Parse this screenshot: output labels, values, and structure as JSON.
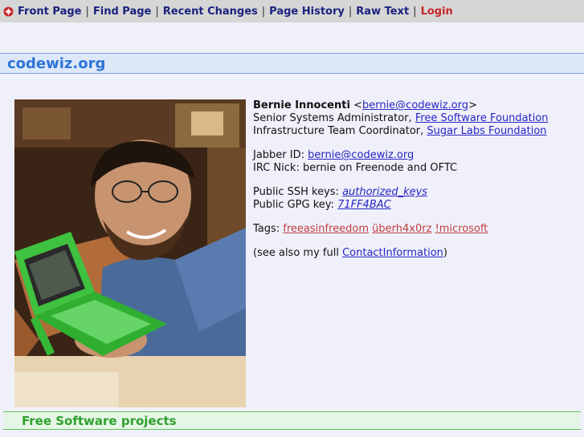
{
  "nav": {
    "items": [
      {
        "label": "Front Page"
      },
      {
        "label": "Find Page"
      },
      {
        "label": "Recent Changes"
      },
      {
        "label": "Page History"
      },
      {
        "label": "Raw Text"
      },
      {
        "label": "Login"
      }
    ],
    "separator": "|"
  },
  "site": {
    "title": "codewiz.org"
  },
  "profile": {
    "name": "Bernie Innocenti",
    "email_open": "<",
    "email": "bernie@codewiz.org",
    "email_close": ">",
    "role1_prefix": "Senior Systems Administrator, ",
    "role1_org": "Free Software Foundation",
    "role2_prefix": "Infrastructure Team Coordinator, ",
    "role2_org": "Sugar Labs Foundation",
    "jabber_label": "Jabber ID: ",
    "jabber_id": "bernie@codewiz.org",
    "irc": "IRC Nick: bernie on Freenode and OFTC",
    "ssh_label": "Public SSH keys: ",
    "ssh_link": "authorized_keys",
    "gpg_label": "Public GPG key: ",
    "gpg_link": "71FF4BAC",
    "tags_label": "Tags: ",
    "tags": [
      "freeasinfreedom",
      "überh4x0rz",
      "!microsoft"
    ],
    "see_also_prefix": "(see also my full ",
    "see_also_link": "ContactInformation",
    "see_also_suffix": ")"
  },
  "section": {
    "title": "Free Software projects"
  },
  "colors": {
    "nav_link": "#1a237e",
    "login_link": "#c62828",
    "site_title": "#2d74d8",
    "section_title": "#2ea02e",
    "tag_link": "#c04040"
  }
}
